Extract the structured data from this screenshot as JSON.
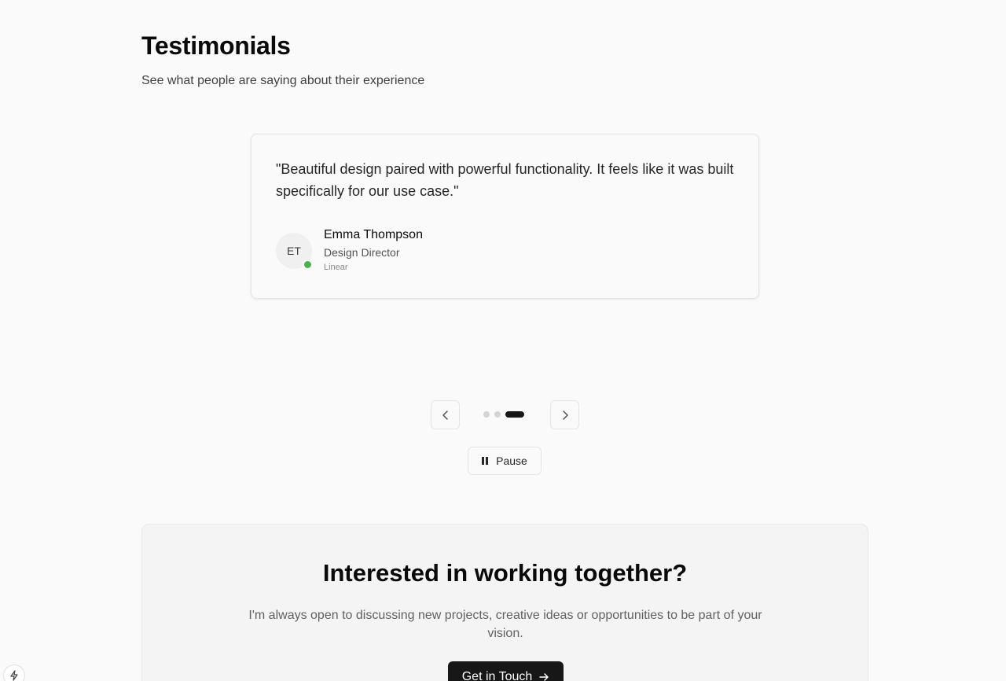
{
  "testimonials": {
    "title": "Testimonials",
    "subtitle": "See what people are saying about their experience",
    "current": {
      "quote": "\"Beautiful design paired with powerful functionality. It feels like it was built specifically for our use case.\"",
      "initials": "ET",
      "name": "Emma Thompson",
      "role": "Design Director",
      "company": "Linear"
    },
    "slide_count": 3,
    "active_slide": 3,
    "pause_label": "Pause"
  },
  "cta": {
    "title": "Interested in working together?",
    "text": "I'm always open to discussing new projects, creative ideas or opportunities to be part of your vision.",
    "button_label": "Get in Touch"
  },
  "icons": {
    "prev": "chevron-left-icon",
    "next": "chevron-right-icon",
    "pause": "pause-icon",
    "arrow": "arrow-right-icon",
    "badge": "lightning-bolt-icon"
  },
  "colors": {
    "status_online": "#4caf50",
    "primary": "#171717"
  }
}
